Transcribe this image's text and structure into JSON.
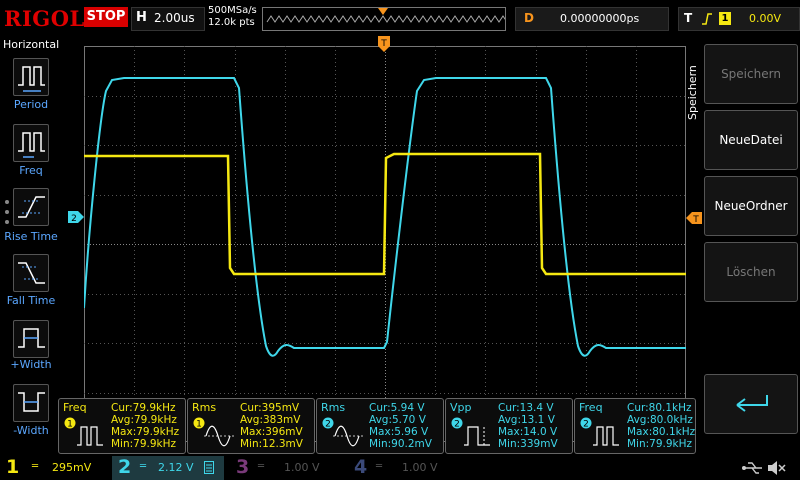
{
  "brand": "RIGOL",
  "run_state": "STOP",
  "timebase": {
    "letter": "H",
    "value": "2.00us"
  },
  "sample_rate": "500MSa/s",
  "memory_depth": "12.0k pts",
  "delay": {
    "letter": "D",
    "value": "0.00000000ps"
  },
  "trigger": {
    "letter": "T",
    "source": "1",
    "level": "0.00V"
  },
  "left_panel": {
    "title": "Horizontal",
    "items": [
      {
        "label": "Period"
      },
      {
        "label": "Freq"
      },
      {
        "label": "Rise Time"
      },
      {
        "label": "Fall Time"
      },
      {
        "label": "+Width"
      },
      {
        "label": "-Width"
      }
    ]
  },
  "right_panel": {
    "title": "Speichern",
    "softkeys": [
      {
        "label": "Speichern",
        "enabled": false
      },
      {
        "label": "NeueDatei",
        "enabled": true
      },
      {
        "label": "NeueOrdner",
        "enabled": true
      },
      {
        "label": "Löschen",
        "enabled": false
      },
      {
        "label": "",
        "enabled": true
      }
    ]
  },
  "markers": {
    "top_trigger": "T",
    "ch2": "2",
    "right_trigger": "T"
  },
  "measurements": [
    {
      "name": "Freq",
      "channel": "1",
      "color": "#f5e812",
      "cur": "Cur:79.9kHz",
      "avg": "Avg:79.9kHz",
      "max": "Max:79.9kHz",
      "min": "Min:79.9kHz",
      "icon": "freq-icon"
    },
    {
      "name": "Rms",
      "channel": "1",
      "color": "#f5e812",
      "cur": "Cur:395mV",
      "avg": "Avg:383mV",
      "max": "Max:396mV",
      "min": "Min:12.3mV",
      "icon": "rms-icon"
    },
    {
      "name": "Rms",
      "channel": "2",
      "color": "#3fd7ea",
      "cur": "Cur:5.94 V",
      "avg": "Avg:5.70 V",
      "max": "Max:5.96 V",
      "min": "Min:90.2mV",
      "icon": "rms-icon"
    },
    {
      "name": "Vpp",
      "channel": "2",
      "color": "#3fd7ea",
      "cur": "Cur:13.4 V",
      "avg": "Avg:13.1 V",
      "max": "Max:14.0 V",
      "min": "Min:339mV",
      "icon": "vpp-icon"
    },
    {
      "name": "Freq",
      "channel": "2",
      "color": "#3fd7ea",
      "cur": "Cur:80.1kHz",
      "avg": "Avg:80.0kHz",
      "max": "Max:80.1kHz",
      "min": "Min:79.9kHz",
      "icon": "freq-icon"
    }
  ],
  "channels": [
    {
      "num": "1",
      "scale": "295mV",
      "color": "#f5e812",
      "active": true
    },
    {
      "num": "2",
      "scale": "2.12 V",
      "color": "#3fd7ea",
      "active": true
    },
    {
      "num": "3",
      "scale": "1.00 V",
      "color": "#7a3a7a",
      "active": false
    },
    {
      "num": "4",
      "scale": "1.00 V",
      "color": "#3b4a7a",
      "active": false
    }
  ],
  "colors": {
    "ch1": "#f5e812",
    "ch2": "#3fd7ea",
    "accent": "#f7941d",
    "brand": "#e00000",
    "label_blue": "#5ba7ff"
  }
}
